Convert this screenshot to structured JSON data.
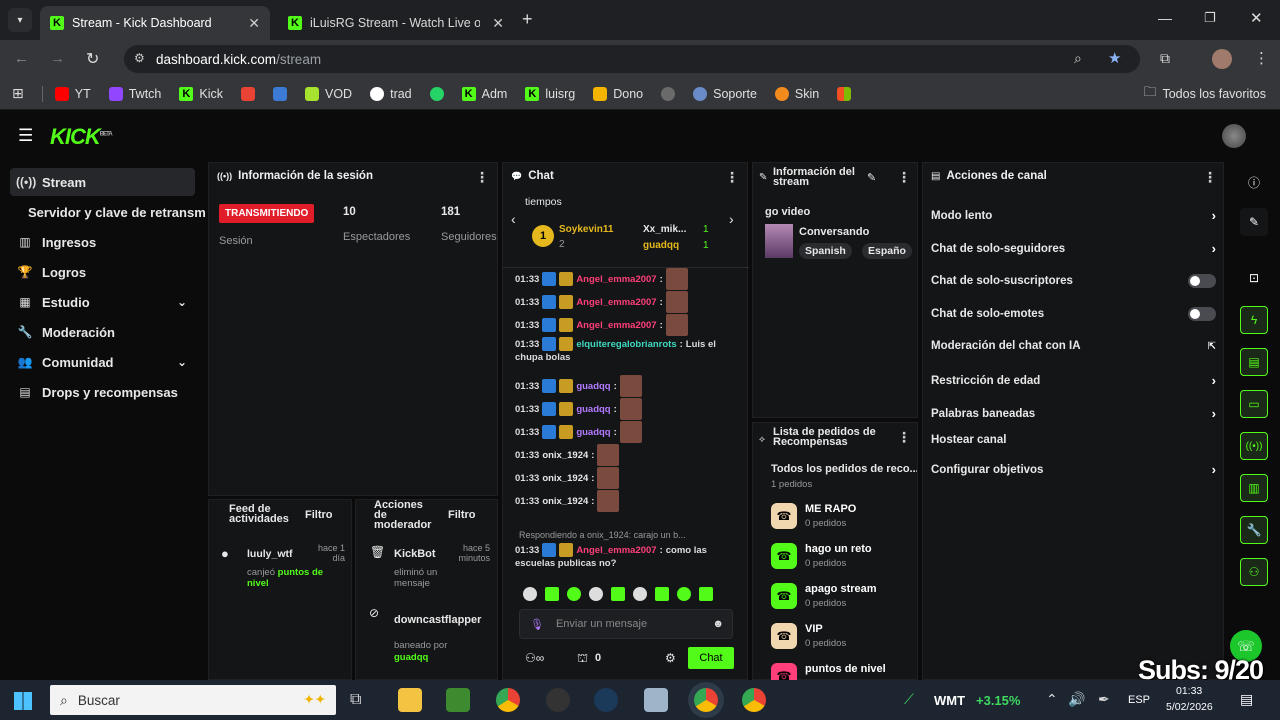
{
  "browser": {
    "tabs": [
      {
        "title": "Stream - Kick Dashboard"
      },
      {
        "title": "iLuisRG Stream - Watch Live on"
      }
    ],
    "url_domain": "dashboard.kick.com",
    "url_path": "/stream",
    "bookmarks": [
      "YT",
      "Twtch",
      "Kick",
      "VOD",
      "trad",
      "Adm",
      "luisrg",
      "Dono",
      "Soporte",
      "Skin"
    ],
    "all_favorites": "Todos los favoritos"
  },
  "kick": {
    "logo": "KICK",
    "beta": "BETA"
  },
  "sidebar": {
    "items": [
      {
        "label": "Stream"
      },
      {
        "label": "Servidor y clave de retransmisión"
      },
      {
        "label": "Ingresos"
      },
      {
        "label": "Logros"
      },
      {
        "label": "Estudio"
      },
      {
        "label": "Moderación"
      },
      {
        "label": "Comunidad"
      },
      {
        "label": "Drops y recompensas"
      }
    ]
  },
  "session": {
    "title": "Información de la sesión",
    "status": "TRANSMITIENDO",
    "status_label": "Sesión",
    "viewers": "10",
    "viewers_label": "Espectadores",
    "followers": "181",
    "followers_label": "Seguidores"
  },
  "activity": {
    "title": "Feed de actividades",
    "filter": "Filtro",
    "items": [
      {
        "user": "luuly_wtf",
        "time": "hace 1 día",
        "text_a": "canjeó ",
        "text_b": "puntos de nivel"
      }
    ]
  },
  "modactions": {
    "title": "Acciones de moderador",
    "filter": "Filtro",
    "items": [
      {
        "user": "KickBot",
        "time": "hace 5 minutos",
        "text": "eliminó un mensaje"
      },
      {
        "user": "downcastflapper",
        "text": "baneado por",
        "by": "guadqq"
      }
    ]
  },
  "chat": {
    "title": "Chat",
    "subtitle": "tiempos",
    "top": [
      {
        "name": "Soykevin11",
        "count": "2"
      },
      {
        "name": "Xx_mik...",
        "count": "1"
      },
      {
        "name": "guadqq",
        "count": "1"
      }
    ],
    "lines": [
      {
        "time": "01:33",
        "user": "Angel_emma2007"
      },
      {
        "time": "01:33",
        "user": "Angel_emma2007"
      },
      {
        "time": "01:33",
        "user": "Angel_emma2007"
      },
      {
        "time": "01:33",
        "user": "elquiteregalobrianrots",
        "msg": "Luis el"
      },
      {
        "time": "",
        "msg": "chupa bolas"
      },
      {
        "time": "01:33",
        "user": "guadqq"
      },
      {
        "time": "01:33",
        "user": "guadqq"
      },
      {
        "time": "01:33",
        "user": "guadqq"
      },
      {
        "time": "01:33",
        "user": "onix_1924"
      },
      {
        "time": "01:33",
        "user": "onix_1924"
      },
      {
        "time": "01:33",
        "user": "onix_1924"
      }
    ],
    "reply_note": "Respondiendo a onix_1924: carajo un b...",
    "last": {
      "time": "01:33",
      "user": "Angel_emma2007",
      "msg": "como las",
      "msg2": "escuelas publicas no?"
    },
    "placeholder": "Enviar un mensaje",
    "points": "0",
    "send_label": "Chat"
  },
  "streaminfo": {
    "title": "Información del stream",
    "stream_title": "go video",
    "category": "Conversando",
    "tags": [
      "Spanish",
      "Españo"
    ]
  },
  "rewards": {
    "title": "Lista de pedidos de Recompensas",
    "all_label": "Todos los pedidos de reco...",
    "all_count": "1 pedidos",
    "items": [
      {
        "name": "ME RAPO",
        "count": "0 pedidos",
        "color": "#f1d7b0"
      },
      {
        "name": "hago un reto",
        "count": "0 pedidos",
        "color": "#53fc18"
      },
      {
        "name": "apago stream",
        "count": "0 pedidos",
        "color": "#53fc18"
      },
      {
        "name": "VIP",
        "count": "0 pedidos",
        "color": "#f1d7b0"
      },
      {
        "name": "puntos de nivel",
        "count": "",
        "color": "#ff3f7a"
      }
    ]
  },
  "channel": {
    "title": "Acciones de canal",
    "items": [
      {
        "label": "Modo lento",
        "type": "arrow"
      },
      {
        "label": "Chat de solo-seguidores",
        "type": "arrow"
      },
      {
        "label": "Chat de solo-suscriptores",
        "type": "toggle"
      },
      {
        "label": "Chat de solo-emotes",
        "type": "toggle"
      },
      {
        "label": "Moderación del chat con IA",
        "type": "external"
      },
      {
        "label": "Restricción de edad",
        "type": "arrow"
      },
      {
        "label": "Palabras baneadas",
        "type": "arrow"
      },
      {
        "label": "Hostear canal",
        "type": "none"
      },
      {
        "label": "Configurar objetivos",
        "type": "arrow"
      }
    ]
  },
  "overlay": {
    "subs": "Subs: 9/20"
  },
  "taskbar": {
    "search": "Buscar",
    "ticker": "WMT",
    "change": "+3.15%",
    "lang": "ESP",
    "time": "01:33",
    "date": "5/02/2026"
  },
  "colors": {
    "kick_green": "#53fc18",
    "live_red": "#e11d2a"
  }
}
